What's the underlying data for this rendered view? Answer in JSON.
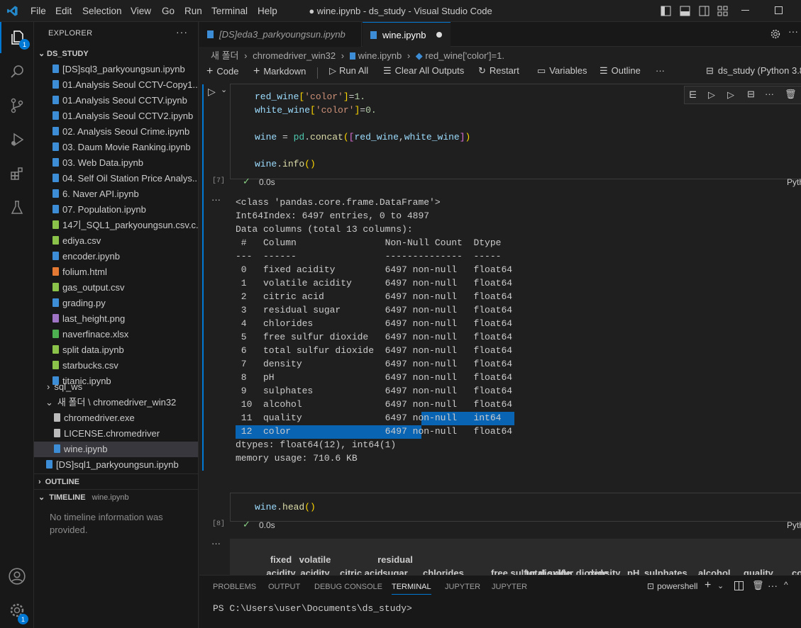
{
  "titlebar": {
    "menus": [
      "File",
      "Edit",
      "Selection",
      "View",
      "Go",
      "Run",
      "Terminal",
      "Help"
    ],
    "window_title": "● wine.ipynb - ds_study - Visual Studio Code"
  },
  "activity": {
    "explorer_badge": "1",
    "settings_badge": "1"
  },
  "sidebar": {
    "title": "EXPLORER",
    "root": "DS_STUDY",
    "files": [
      {
        "name": "[DS]sql3_parkyoungsun.ipynb",
        "kind": "nb"
      },
      {
        "name": "01.Analysis Seoul CCTV-Copy1....",
        "kind": "nb"
      },
      {
        "name": "01.Analysis Seoul CCTV.ipynb",
        "kind": "nb"
      },
      {
        "name": "01.Analysis Seoul CCTV2.ipynb",
        "kind": "nb"
      },
      {
        "name": "02. Analysis Seoul Crime.ipynb",
        "kind": "nb"
      },
      {
        "name": "03. Daum Movie Ranking.ipynb",
        "kind": "nb"
      },
      {
        "name": "03. Web Data.ipynb",
        "kind": "nb"
      },
      {
        "name": "04. Self Oil Station Price Analys...",
        "kind": "nb"
      },
      {
        "name": "6. Naver API.ipynb",
        "kind": "nb"
      },
      {
        "name": "07. Population.ipynb",
        "kind": "nb"
      },
      {
        "name": "14기_SQL1_parkyoungsun.csv.c...",
        "kind": "csv"
      },
      {
        "name": "ediya.csv",
        "kind": "csv"
      },
      {
        "name": "encoder.ipynb",
        "kind": "nb"
      },
      {
        "name": "folium.html",
        "kind": "html"
      },
      {
        "name": "gas_output.csv",
        "kind": "csv"
      },
      {
        "name": "grading.py",
        "kind": "py"
      },
      {
        "name": "last_height.png",
        "kind": "png"
      },
      {
        "name": "naverfinace.xlsx",
        "kind": "xlsx"
      },
      {
        "name": "split data.ipynb",
        "kind": "csv"
      },
      {
        "name": "starbucks.csv",
        "kind": "csv"
      },
      {
        "name": "titanic.ipynb",
        "kind": "nb"
      }
    ],
    "folder_sql_ws": "sql_ws",
    "folder_new": "새 폴더 \\ chromedriver_win32",
    "sub_files": [
      {
        "name": "chromedriver.exe",
        "kind": "txt"
      },
      {
        "name": "LICENSE.chromedriver",
        "kind": "txt"
      },
      {
        "name": "wine.ipynb",
        "kind": "nb"
      }
    ],
    "last_file": "[DS]sql1_parkyoungsun.ipynb",
    "outline": "OUTLINE",
    "timeline": "TIMELINE",
    "timeline_file": "wine.ipynb",
    "timeline_msg": "No timeline information was provided."
  },
  "editor": {
    "tabs": [
      {
        "label": "[DS]eda3_parkyoungsun.ipynb",
        "active": false
      },
      {
        "label": "wine.ipynb",
        "active": true
      }
    ],
    "breadcrumb": [
      "새 폴더",
      "chromedriver_win32",
      "wine.ipynb",
      "red_wine['color']=1."
    ],
    "toolbar": {
      "code": "Code",
      "markdown": "Markdown",
      "run_all": "Run All",
      "clear": "Clear All Outputs",
      "restart": "Restart",
      "variables": "Variables",
      "outline": "Outline",
      "kernel": "ds_study (Python 3.8"
    },
    "cell1": {
      "exec": "[7]",
      "time": "0.0s",
      "lang": "Pyth",
      "lines": [
        "red_wine['color']=1.",
        "white_wine['color']=0.",
        "",
        "wine = pd.concat([red_wine,white_wine])",
        "",
        "wine.info()"
      ]
    },
    "output": [
      "<class 'pandas.core.frame.DataFrame'>",
      "Int64Index: 6497 entries, 0 to 4897",
      "Data columns (total 13 columns):",
      " #   Column                Non-Null Count  Dtype  ",
      "---  ------                --------------  -----  ",
      " 0   fixed acidity         6497 non-null   float64",
      " 1   volatile acidity      6497 non-null   float64",
      " 2   citric acid           6497 non-null   float64",
      " 3   residual sugar        6497 non-null   float64",
      " 4   chlorides             6497 non-null   float64",
      " 5   free sulfur dioxide   6497 non-null   float64",
      " 6   total sulfur dioxide  6497 non-null   float64",
      " 7   density               6497 non-null   float64",
      " 8   pH                    6497 non-null   float64",
      " 9   sulphates             6497 non-null   float64",
      " 10  alcohol               6497 non-null   float64",
      " 11  quality               6497 non-null   int64  ",
      " 12  color                 6497 non-null   float64",
      "dtypes: float64(12), int64(1)",
      "memory usage: 710.6 KB"
    ],
    "cell2": {
      "exec": "[8]",
      "time": "0.0s",
      "lang": "Pyth",
      "code": "wine.head()"
    },
    "table_headers": [
      "fixed acidity",
      "volatile acidity",
      "citric acid",
      "residual sugar",
      "chlorides",
      "free sulfur dioxide",
      "total sulfur dioxide",
      "density",
      "pH",
      "sulphates",
      "alcohol",
      "quality",
      "col"
    ]
  },
  "panel": {
    "tabs": [
      "PROBLEMS",
      "OUTPUT",
      "DEBUG CONSOLE",
      "TERMINAL",
      "JUPYTER",
      "JUPYTER"
    ],
    "active_tab": "TERMINAL",
    "shell": "powershell",
    "prompt": "PS C:\\Users\\user\\Documents\\ds_study>"
  },
  "colors": {
    "accent": "#0078d4",
    "selection": "#0a64b4",
    "string": "#ce9178",
    "func": "#dcdcaa",
    "var": "#9cdcfe"
  }
}
